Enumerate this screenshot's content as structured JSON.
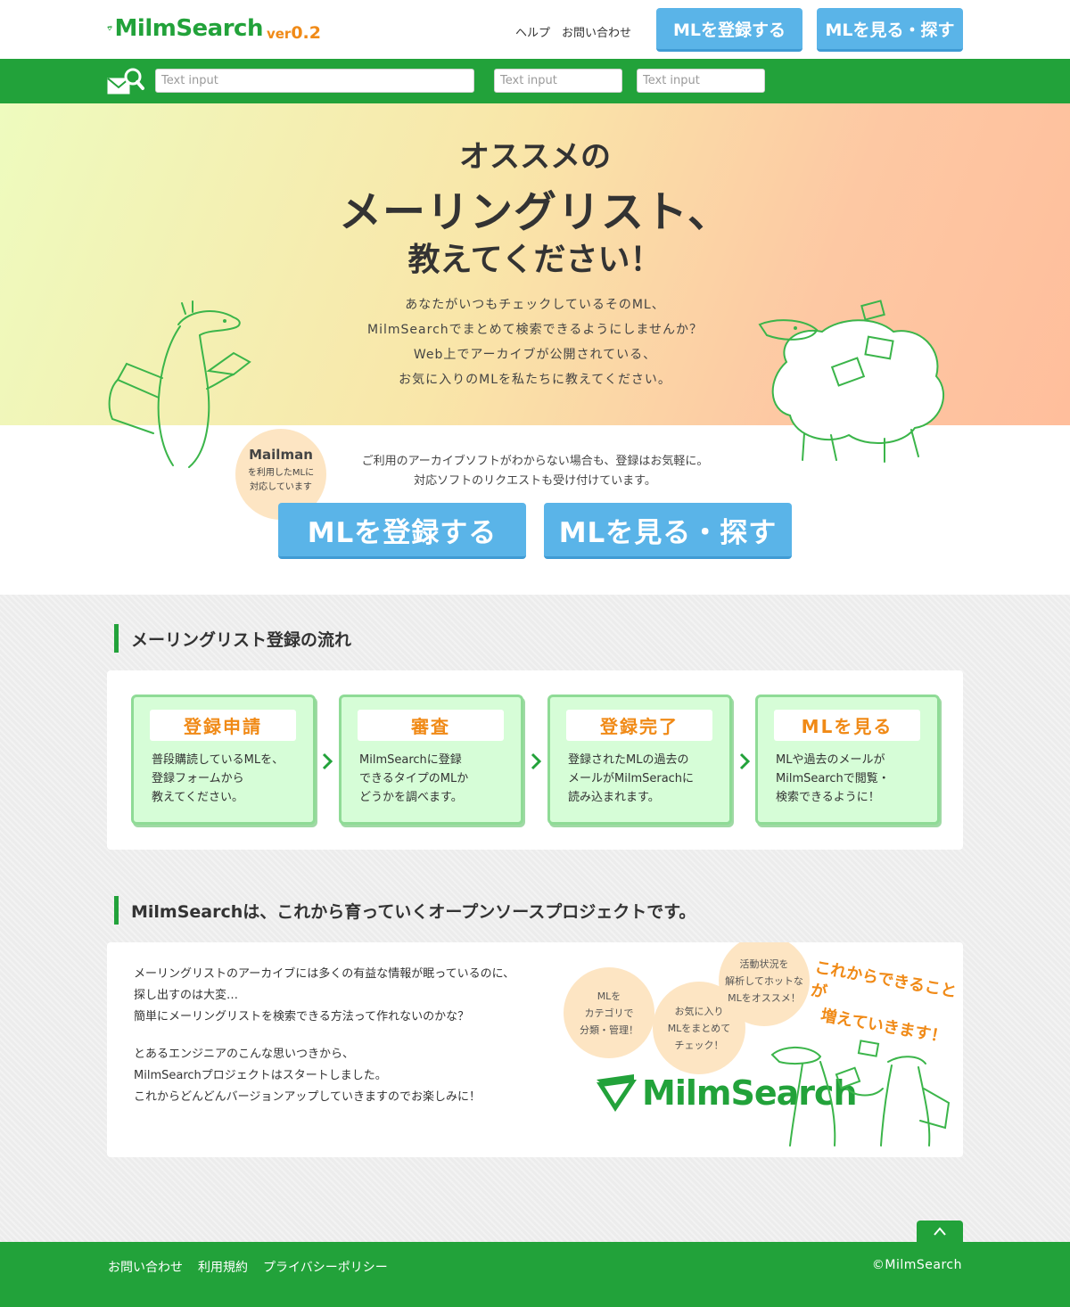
{
  "header": {
    "logo_text": "MilmSearch",
    "logo_ver_prefix": "ver",
    "logo_ver_num": "0.2",
    "links": [
      "ヘルプ",
      "お問い合わせ"
    ],
    "register_label": "MLを登録する",
    "browse_label": "MLを見る・探す"
  },
  "searchbar": {
    "inputs": [
      {
        "placeholder": "Text input"
      },
      {
        "placeholder": "Text input"
      },
      {
        "placeholder": "Text input"
      }
    ]
  },
  "hero": {
    "line1": "オススメの",
    "line2": "メーリングリスト、",
    "line3": "教えてください！",
    "paragraph": [
      "あなたがいつもチェックしているそのML、",
      "MilmSearchでまとめて検索できるようにしませんか？",
      "Web上でアーカイブが公開されている、",
      "お気に入りのMLを私たちに教えてください。"
    ]
  },
  "mailman_badge": {
    "title": "Mailman",
    "line1": "を利用したMLに",
    "line2": "対応しています"
  },
  "register_note": [
    "ご利用のアーカイブソフトがわからない場合も、登録はお気軽に。",
    "対応ソフトのリクエストも受け付けています。"
  ],
  "cta": {
    "register_label": "MLを登録する",
    "browse_label": "MLを見る・探す"
  },
  "flow": {
    "title": "メーリングリスト登録の流れ",
    "steps": [
      {
        "title": "登録申請",
        "body": [
          "普段購読しているMLを、",
          "登録フォームから",
          "教えてください。"
        ]
      },
      {
        "title": "審査",
        "body": [
          "MilmSearchに登録",
          "できるタイプのMLか",
          "どうかを調べます。"
        ]
      },
      {
        "title": "登録完了",
        "body": [
          "登録されたMLの過去の",
          "メールがMilmSerachに",
          "読み込まれます。"
        ]
      },
      {
        "title": "MLを見る",
        "body": [
          "MLや過去のメールが",
          "MilmSearchで閲覧・",
          "検索できるように！"
        ]
      }
    ]
  },
  "oss": {
    "title": "MilmSearchは、これから育っていくオープンソースプロジェクトです。",
    "para1": [
      "メーリングリストのアーカイブには多くの有益な情報が眠っているのに、",
      "探し出すのは大変…",
      "簡単にメーリングリストを検索できる方法って作れないのかな？"
    ],
    "para2": [
      "とあるエンジニアのこんな思いつきから、",
      "MilmSearchプロジェクトはスタートしました。",
      "これからどんどんバージョンアップしていきますのでお楽しみに！"
    ],
    "bubbles": [
      [
        "MLを",
        "カテゴリで",
        "分類・管理！"
      ],
      [
        "お気に入り",
        "MLをまとめて",
        "チェック！"
      ],
      [
        "活動状況を",
        "解析してホットな",
        "MLをオススメ！"
      ]
    ],
    "orange_copy": [
      "これからできることが",
      "増えていきます！"
    ],
    "logo_text": "MilmSearch"
  },
  "footer": {
    "links": [
      "お問い合わせ",
      "利用規約",
      "プライバシーポリシー"
    ],
    "copyright": "©MilmSearch"
  },
  "colors": {
    "brand_green": "#22a23a",
    "accent_orange": "#f08a17",
    "button_blue": "#5ab4e8",
    "step_bg": "#d6fdd7"
  },
  "icons": [
    "logo-mark-icon",
    "mail-search-icon",
    "chevron-right-icon",
    "chevron-up-icon"
  ]
}
